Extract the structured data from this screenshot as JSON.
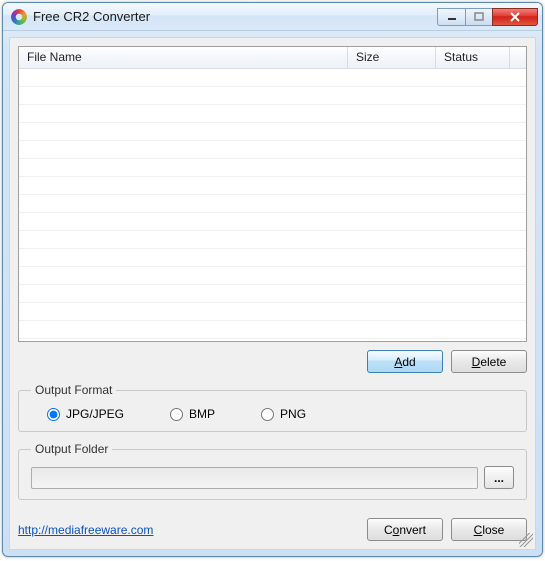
{
  "window": {
    "title": "Free CR2 Converter"
  },
  "table": {
    "columns": {
      "name": "File Name",
      "size": "Size",
      "status": "Status"
    },
    "rows": []
  },
  "buttons": {
    "add": "Add",
    "delete": "Delete",
    "browse": "...",
    "convert": "Convert",
    "close": "Close"
  },
  "format": {
    "legend": "Output Format",
    "selected": "jpg",
    "options": {
      "jpg": "JPG/JPEG",
      "bmp": "BMP",
      "png": "PNG"
    }
  },
  "folder": {
    "legend": "Output Folder",
    "value": ""
  },
  "link": {
    "text": "http://mediafreeware.com",
    "url": "http://mediafreeware.com"
  }
}
